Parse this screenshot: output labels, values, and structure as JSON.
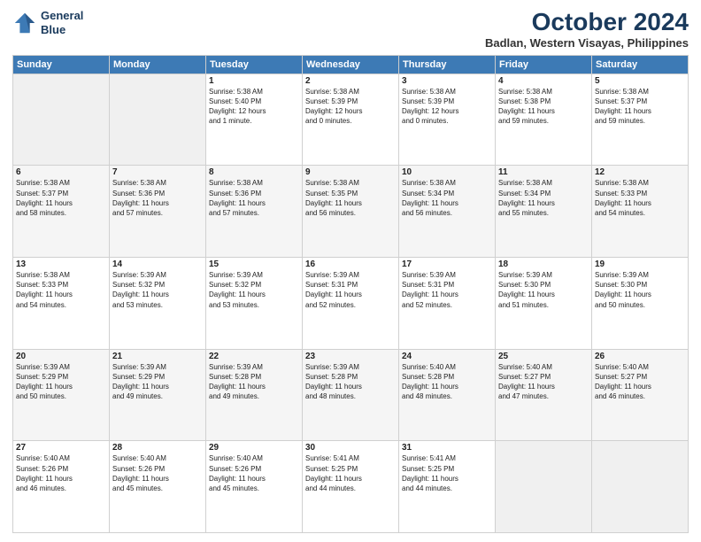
{
  "logo": {
    "line1": "General",
    "line2": "Blue"
  },
  "title": "October 2024",
  "subtitle": "Badlan, Western Visayas, Philippines",
  "days_header": [
    "Sunday",
    "Monday",
    "Tuesday",
    "Wednesday",
    "Thursday",
    "Friday",
    "Saturday"
  ],
  "weeks": [
    [
      {
        "day": "",
        "info": ""
      },
      {
        "day": "",
        "info": ""
      },
      {
        "day": "1",
        "info": "Sunrise: 5:38 AM\nSunset: 5:40 PM\nDaylight: 12 hours\nand 1 minute."
      },
      {
        "day": "2",
        "info": "Sunrise: 5:38 AM\nSunset: 5:39 PM\nDaylight: 12 hours\nand 0 minutes."
      },
      {
        "day": "3",
        "info": "Sunrise: 5:38 AM\nSunset: 5:39 PM\nDaylight: 12 hours\nand 0 minutes."
      },
      {
        "day": "4",
        "info": "Sunrise: 5:38 AM\nSunset: 5:38 PM\nDaylight: 11 hours\nand 59 minutes."
      },
      {
        "day": "5",
        "info": "Sunrise: 5:38 AM\nSunset: 5:37 PM\nDaylight: 11 hours\nand 59 minutes."
      }
    ],
    [
      {
        "day": "6",
        "info": "Sunrise: 5:38 AM\nSunset: 5:37 PM\nDaylight: 11 hours\nand 58 minutes."
      },
      {
        "day": "7",
        "info": "Sunrise: 5:38 AM\nSunset: 5:36 PM\nDaylight: 11 hours\nand 57 minutes."
      },
      {
        "day": "8",
        "info": "Sunrise: 5:38 AM\nSunset: 5:36 PM\nDaylight: 11 hours\nand 57 minutes."
      },
      {
        "day": "9",
        "info": "Sunrise: 5:38 AM\nSunset: 5:35 PM\nDaylight: 11 hours\nand 56 minutes."
      },
      {
        "day": "10",
        "info": "Sunrise: 5:38 AM\nSunset: 5:34 PM\nDaylight: 11 hours\nand 56 minutes."
      },
      {
        "day": "11",
        "info": "Sunrise: 5:38 AM\nSunset: 5:34 PM\nDaylight: 11 hours\nand 55 minutes."
      },
      {
        "day": "12",
        "info": "Sunrise: 5:38 AM\nSunset: 5:33 PM\nDaylight: 11 hours\nand 54 minutes."
      }
    ],
    [
      {
        "day": "13",
        "info": "Sunrise: 5:38 AM\nSunset: 5:33 PM\nDaylight: 11 hours\nand 54 minutes."
      },
      {
        "day": "14",
        "info": "Sunrise: 5:39 AM\nSunset: 5:32 PM\nDaylight: 11 hours\nand 53 minutes."
      },
      {
        "day": "15",
        "info": "Sunrise: 5:39 AM\nSunset: 5:32 PM\nDaylight: 11 hours\nand 53 minutes."
      },
      {
        "day": "16",
        "info": "Sunrise: 5:39 AM\nSunset: 5:31 PM\nDaylight: 11 hours\nand 52 minutes."
      },
      {
        "day": "17",
        "info": "Sunrise: 5:39 AM\nSunset: 5:31 PM\nDaylight: 11 hours\nand 52 minutes."
      },
      {
        "day": "18",
        "info": "Sunrise: 5:39 AM\nSunset: 5:30 PM\nDaylight: 11 hours\nand 51 minutes."
      },
      {
        "day": "19",
        "info": "Sunrise: 5:39 AM\nSunset: 5:30 PM\nDaylight: 11 hours\nand 50 minutes."
      }
    ],
    [
      {
        "day": "20",
        "info": "Sunrise: 5:39 AM\nSunset: 5:29 PM\nDaylight: 11 hours\nand 50 minutes."
      },
      {
        "day": "21",
        "info": "Sunrise: 5:39 AM\nSunset: 5:29 PM\nDaylight: 11 hours\nand 49 minutes."
      },
      {
        "day": "22",
        "info": "Sunrise: 5:39 AM\nSunset: 5:28 PM\nDaylight: 11 hours\nand 49 minutes."
      },
      {
        "day": "23",
        "info": "Sunrise: 5:39 AM\nSunset: 5:28 PM\nDaylight: 11 hours\nand 48 minutes."
      },
      {
        "day": "24",
        "info": "Sunrise: 5:40 AM\nSunset: 5:28 PM\nDaylight: 11 hours\nand 48 minutes."
      },
      {
        "day": "25",
        "info": "Sunrise: 5:40 AM\nSunset: 5:27 PM\nDaylight: 11 hours\nand 47 minutes."
      },
      {
        "day": "26",
        "info": "Sunrise: 5:40 AM\nSunset: 5:27 PM\nDaylight: 11 hours\nand 46 minutes."
      }
    ],
    [
      {
        "day": "27",
        "info": "Sunrise: 5:40 AM\nSunset: 5:26 PM\nDaylight: 11 hours\nand 46 minutes."
      },
      {
        "day": "28",
        "info": "Sunrise: 5:40 AM\nSunset: 5:26 PM\nDaylight: 11 hours\nand 45 minutes."
      },
      {
        "day": "29",
        "info": "Sunrise: 5:40 AM\nSunset: 5:26 PM\nDaylight: 11 hours\nand 45 minutes."
      },
      {
        "day": "30",
        "info": "Sunrise: 5:41 AM\nSunset: 5:25 PM\nDaylight: 11 hours\nand 44 minutes."
      },
      {
        "day": "31",
        "info": "Sunrise: 5:41 AM\nSunset: 5:25 PM\nDaylight: 11 hours\nand 44 minutes."
      },
      {
        "day": "",
        "info": ""
      },
      {
        "day": "",
        "info": ""
      }
    ]
  ]
}
